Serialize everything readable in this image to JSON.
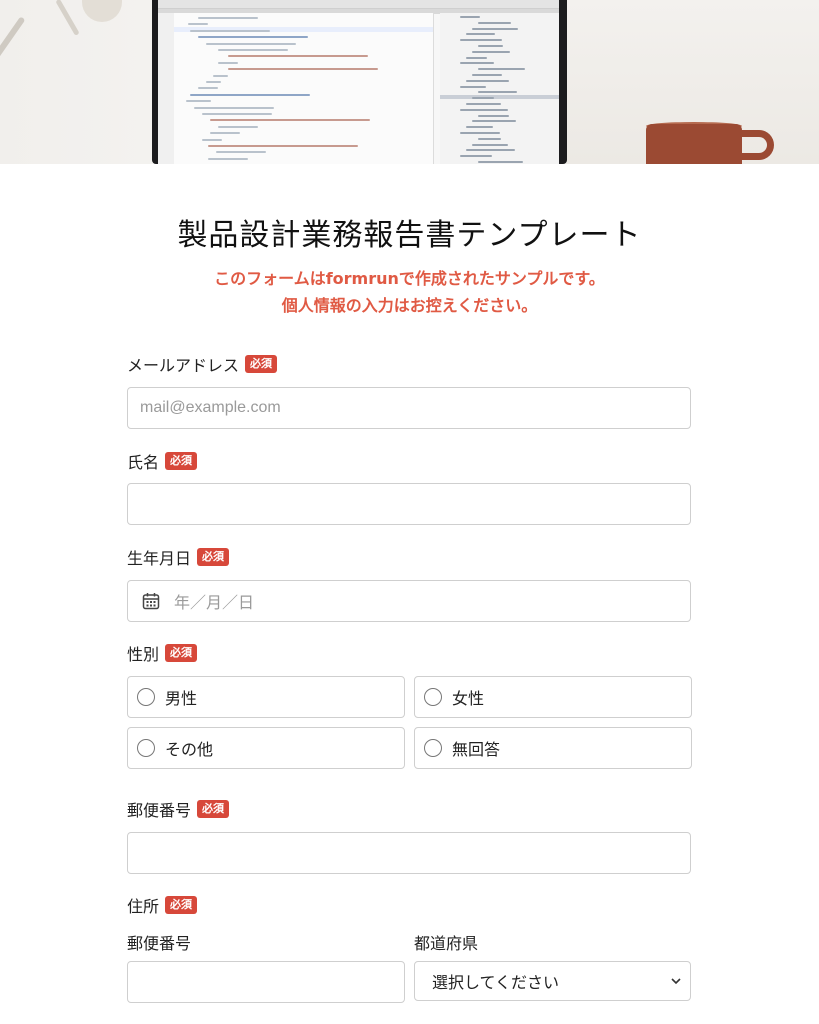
{
  "form": {
    "title": "製品設計業務報告書テンプレート",
    "notice_line1": "このフォームはformrunで作成されたサンプルです。",
    "notice_line2": "個人情報の入力はお控えください。",
    "required_badge": "必須",
    "email": {
      "label": "メールアドレス",
      "placeholder": "mail@example.com"
    },
    "name": {
      "label": "氏名",
      "value": ""
    },
    "birthdate": {
      "label": "生年月日",
      "placeholder": "年／月／日",
      "icon": "calendar-icon"
    },
    "gender": {
      "label": "性別",
      "options": [
        "男性",
        "女性",
        "その他",
        "無回答"
      ]
    },
    "postal_code": {
      "label": "郵便番号",
      "value": ""
    },
    "address": {
      "label": "住所",
      "zip_label": "郵便番号",
      "prefecture_label": "都道府県",
      "prefecture_selected": "選択してください"
    }
  },
  "colors": {
    "accent": "#e05a44",
    "required_badge": "#d7483a",
    "border": "#cfcfcf"
  }
}
